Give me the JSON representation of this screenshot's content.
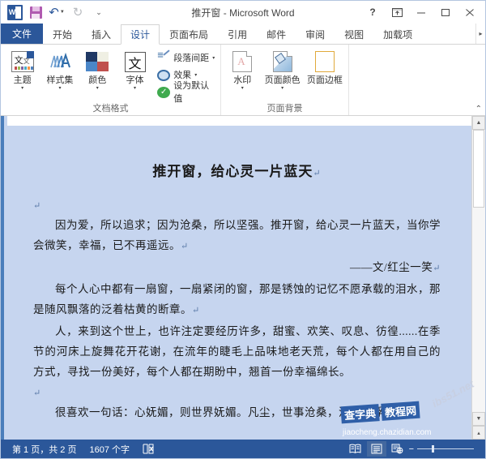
{
  "titlebar": {
    "document_title": "推开窗 - Microsoft Word",
    "app_icon": "word-icon",
    "quick_access": [
      {
        "name": "save-icon",
        "label": "保存"
      },
      {
        "name": "undo-icon",
        "label": "撤消",
        "glyph": "↶"
      },
      {
        "name": "redo-icon",
        "label": "恢复",
        "glyph": "↻"
      },
      {
        "name": "customize-qat-icon",
        "label": "自定义快速访问工具栏",
        "glyph": "⌄"
      }
    ],
    "window_controls": [
      {
        "name": "help-button",
        "glyph": "?"
      },
      {
        "name": "ribbon-display-options-button",
        "glyph": "⊡"
      },
      {
        "name": "minimize-button",
        "glyph": "—"
      },
      {
        "name": "maximize-button",
        "glyph": "▢"
      },
      {
        "name": "close-button",
        "glyph": "✕"
      }
    ]
  },
  "tabs": {
    "file_label": "文件",
    "items": [
      {
        "label": "开始",
        "active": false
      },
      {
        "label": "插入",
        "active": false
      },
      {
        "label": "设计",
        "active": true
      },
      {
        "label": "页面布局",
        "active": false
      },
      {
        "label": "引用",
        "active": false
      },
      {
        "label": "邮件",
        "active": false
      },
      {
        "label": "审阅",
        "active": false
      },
      {
        "label": "视图",
        "active": false
      },
      {
        "label": "加载项",
        "active": false
      }
    ],
    "scroll_glyph": "▸"
  },
  "ribbon": {
    "groups": [
      {
        "label": "文档格式",
        "big_buttons": [
          {
            "label": "主题",
            "icon": "theme-icon",
            "dropdown": "▾"
          },
          {
            "label": "样式集",
            "icon": "style-set-icon",
            "dropdown": "▾"
          },
          {
            "label": "颜色",
            "icon": "colors-icon",
            "dropdown": "▾"
          },
          {
            "label": "字体",
            "icon": "fonts-icon",
            "dropdown": "▾"
          }
        ],
        "small_buttons": [
          {
            "label": "段落间距",
            "icon": "paragraph-spacing-icon",
            "dropdown": "▾"
          },
          {
            "label": "效果",
            "icon": "effects-icon",
            "dropdown": "▾"
          },
          {
            "label": "设为默认值",
            "icon": "set-as-default-icon",
            "dropdown": ""
          }
        ]
      },
      {
        "label": "页面背景",
        "big_buttons": [
          {
            "label": "水印",
            "icon": "watermark-icon",
            "dropdown": "▾"
          },
          {
            "label": "页面颜色",
            "icon": "page-color-icon",
            "dropdown": "▾"
          },
          {
            "label": "页面边框",
            "icon": "page-border-icon",
            "dropdown": ""
          }
        ],
        "small_buttons": []
      }
    ],
    "collapse_glyph": "⌃"
  },
  "document": {
    "page_color": "#c6d5ef",
    "title": "推开窗，给心灵一片蓝天",
    "paragraph_mark": "↵",
    "paragraphs": [
      {
        "text": "",
        "style": "empty"
      },
      {
        "text": "因为爱，所以追求；因为沧桑，所以坚强。推开窗，给心灵一片蓝天，当你学会微笑，幸福，已不再遥远。",
        "style": "indent",
        "mark": true
      },
      {
        "text": "——文/红尘一笑",
        "style": "right",
        "mark": true
      },
      {
        "text": "每个人心中都有一扇窗，一扇紧闭的窗，那是锈蚀的记忆不愿承载的泪水，那是随风飘落的泛着枯黄的断章。",
        "style": "indent",
        "mark": true
      },
      {
        "text": "人，来到这个世上，也许注定要经历许多，甜蜜、欢笑、叹息、彷徨......在季节的河床上旋舞花开花谢，在流年的睫毛上品味地老天荒，每个人都在用自己的方式，寻找一份美好，每个人都在期盼中，翘首一份幸福绵长。",
        "style": "indent",
        "mark": false
      },
      {
        "text": "",
        "style": "empty",
        "mark": true
      },
      {
        "text": "很喜欢一句话：心妩媚，则世界妩媚。凡尘，世事沧桑，流年沉浮，也许",
        "style": "indent",
        "mark": false
      }
    ]
  },
  "scrollbar": {
    "up_glyph": "▲",
    "down_glyph": "▼",
    "extra_glyph": "▴"
  },
  "statusbar": {
    "page_info": "第 1 页，共 2 页",
    "word_count": "1607 个字",
    "proofing_icon": "proofing-errors-icon",
    "views": [
      {
        "name": "read-mode-view-button",
        "label": "阅读视图",
        "active": false
      },
      {
        "name": "print-layout-view-button",
        "label": "页面视图",
        "active": true
      },
      {
        "name": "web-layout-view-button",
        "label": "Web 版式视图",
        "active": false
      }
    ],
    "zoom_minus": "−",
    "zoom_plus": "+"
  },
  "watermark": {
    "box1": "查字典",
    "box2": "教程网",
    "tilt": "ibs51.net",
    "url": "jiaocheng.chazidian.com"
  }
}
